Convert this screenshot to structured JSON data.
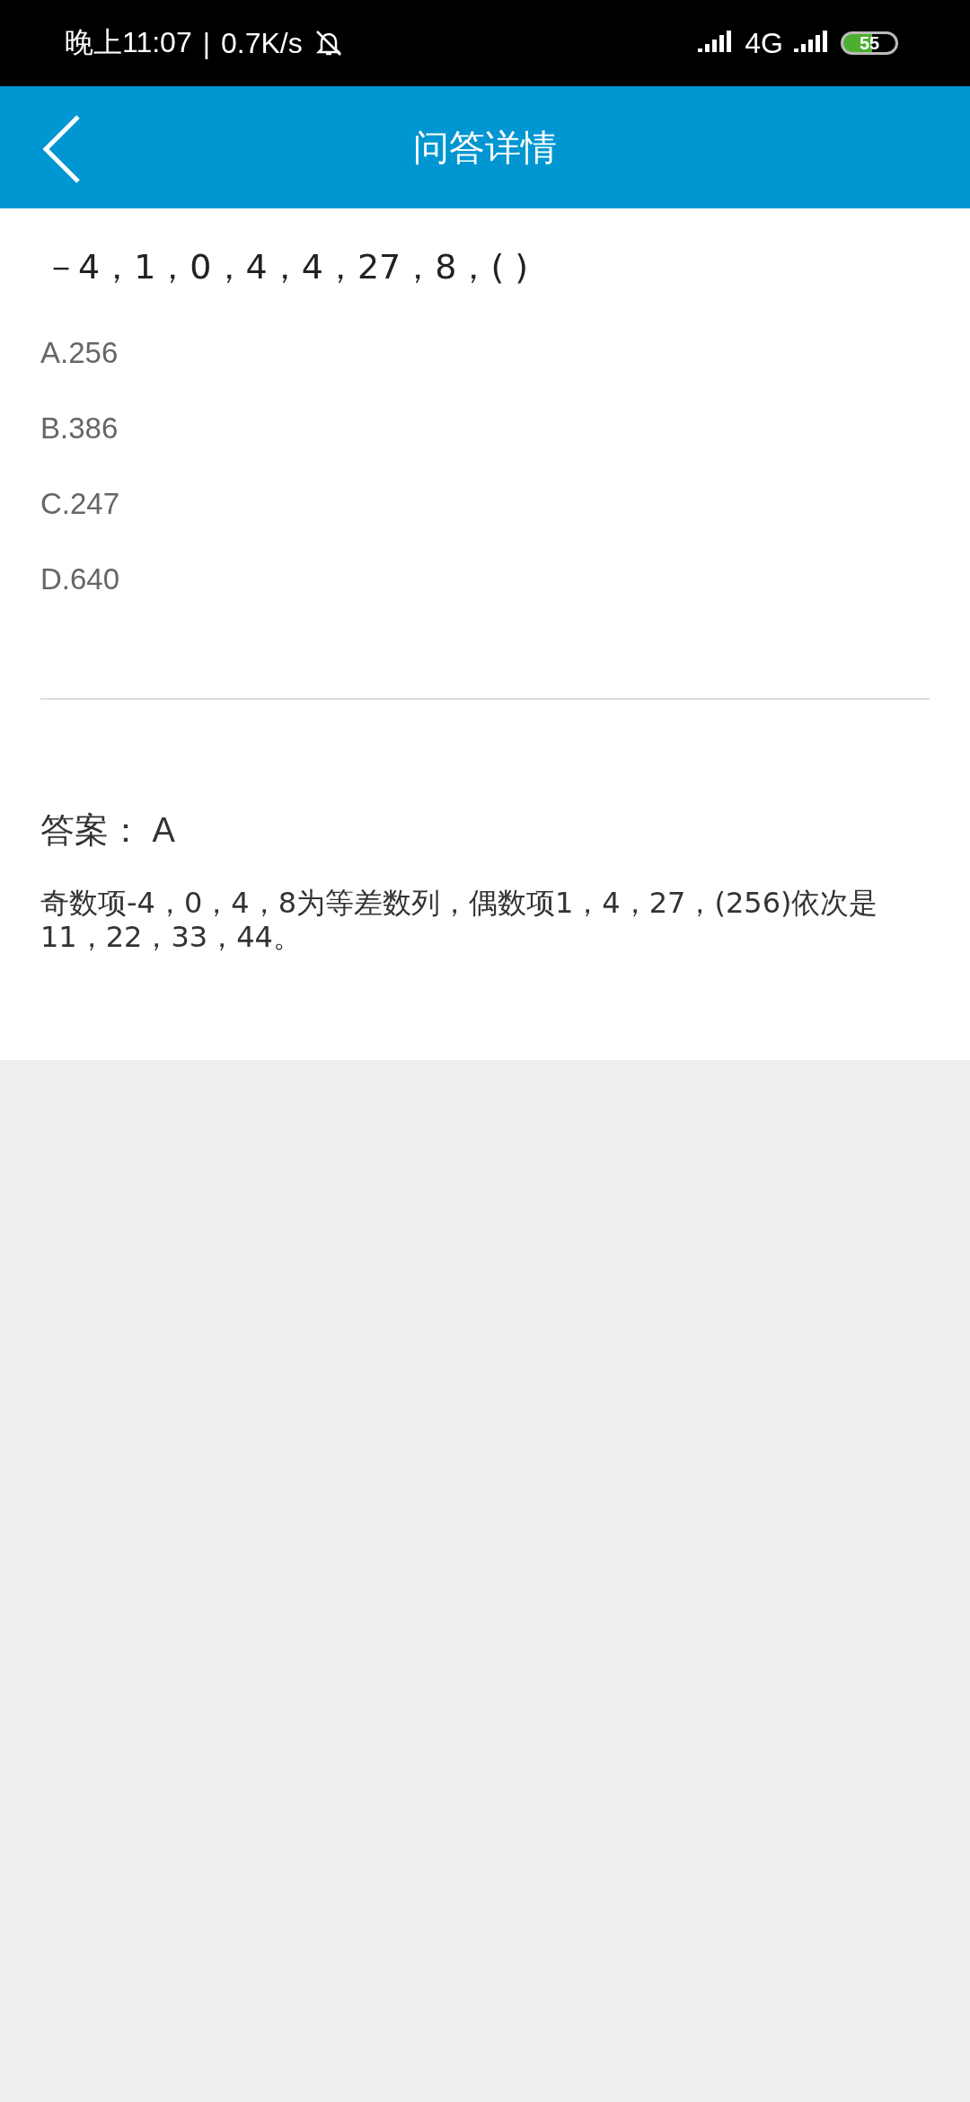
{
  "status_bar": {
    "time": "晚上11:07",
    "separator": "|",
    "speed": "0.7K/s",
    "network": "4G",
    "battery": "55"
  },
  "header": {
    "title": "问答详情"
  },
  "question": {
    "text": "－4，1，0，4，4，27，8，( )",
    "options": [
      "A.256",
      "B.386",
      "C.247",
      "D.640"
    ]
  },
  "answer": {
    "label": "答案：",
    "value": "A",
    "explanation": "奇数项-4，0，4，8为等差数列，偶数项1，4，27，(256)依次是11，22，33，44。"
  }
}
